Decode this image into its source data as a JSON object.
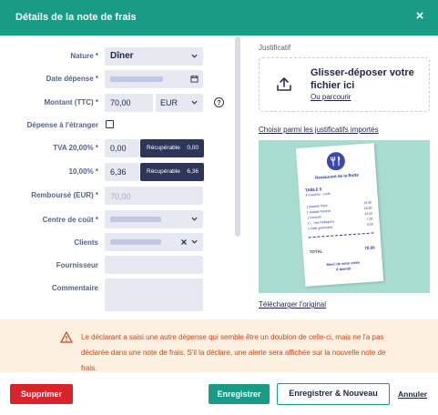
{
  "header": {
    "title": "Détails de la note de frais",
    "close": "×"
  },
  "form": {
    "nature": {
      "label": "Nature *",
      "value": "Dîner"
    },
    "date": {
      "label": "Date dépense *"
    },
    "amount": {
      "label": "Montant (TTC) *",
      "value": "70,00",
      "currency": "EUR",
      "help": "?"
    },
    "foreign": {
      "label": "Dépense à l'étranger"
    },
    "vat1": {
      "label": "TVA 20,00% *",
      "value": "0,00",
      "badge_label": "Récupérable",
      "badge_value": "0,00"
    },
    "vat2": {
      "label": "10,00% *",
      "value": "6,36",
      "badge_label": "Récupérable",
      "badge_value": "6,36"
    },
    "reimbursed": {
      "label": "Remboursé (EUR) *",
      "placeholder": "70,00"
    },
    "cost_center": {
      "label": "Centre de coût *"
    },
    "clients": {
      "label": "Clients"
    },
    "supplier": {
      "label": "Fournisseur"
    },
    "comment": {
      "label": "Commentaire"
    }
  },
  "justificatif": {
    "title": "Justificatif",
    "drop_text": "Glisser-déposer votre fichier ici",
    "browse": "Ou parcourir",
    "choose_link": "Choisir parmi les justificatifs importés",
    "download_link": "Télécharger l'original"
  },
  "receipt": {
    "restaurant": "Restaurant de la Butte",
    "table": "TABLE 5",
    "covers": "4 couverts - Louis",
    "lines": [
      "1 Bavette frites",
      "1 Salade Niçoise",
      "1 Gnocchi",
      "1 L. San Pellegrino",
      "1 Café gourmand"
    ],
    "prices": [
      "19,50",
      "16,00",
      "14,50",
      "7,00",
      "9,00"
    ],
    "total_label": "TOTAL",
    "total": "70,00",
    "footer": "Merci de votre visite",
    "footer2": "À bientôt"
  },
  "alert": {
    "text": "Le déclarant a saisi une autre dépense qui semble être un doublon de celle-ci, mais ne l'a pas déclarée dans une note de frais. S'il la déclare, une alerte sera affichée sur la nouvelle note de frais."
  },
  "footer": {
    "delete": "Supprimer",
    "save": "Enregistrer",
    "save_new": "Enregistrer & Nouveau",
    "cancel": "Annuler"
  },
  "colors": {
    "accent": "#1a9b86",
    "danger": "#d8232a",
    "warning_bg": "#fdf0e0",
    "warning_text": "#c4491d"
  }
}
